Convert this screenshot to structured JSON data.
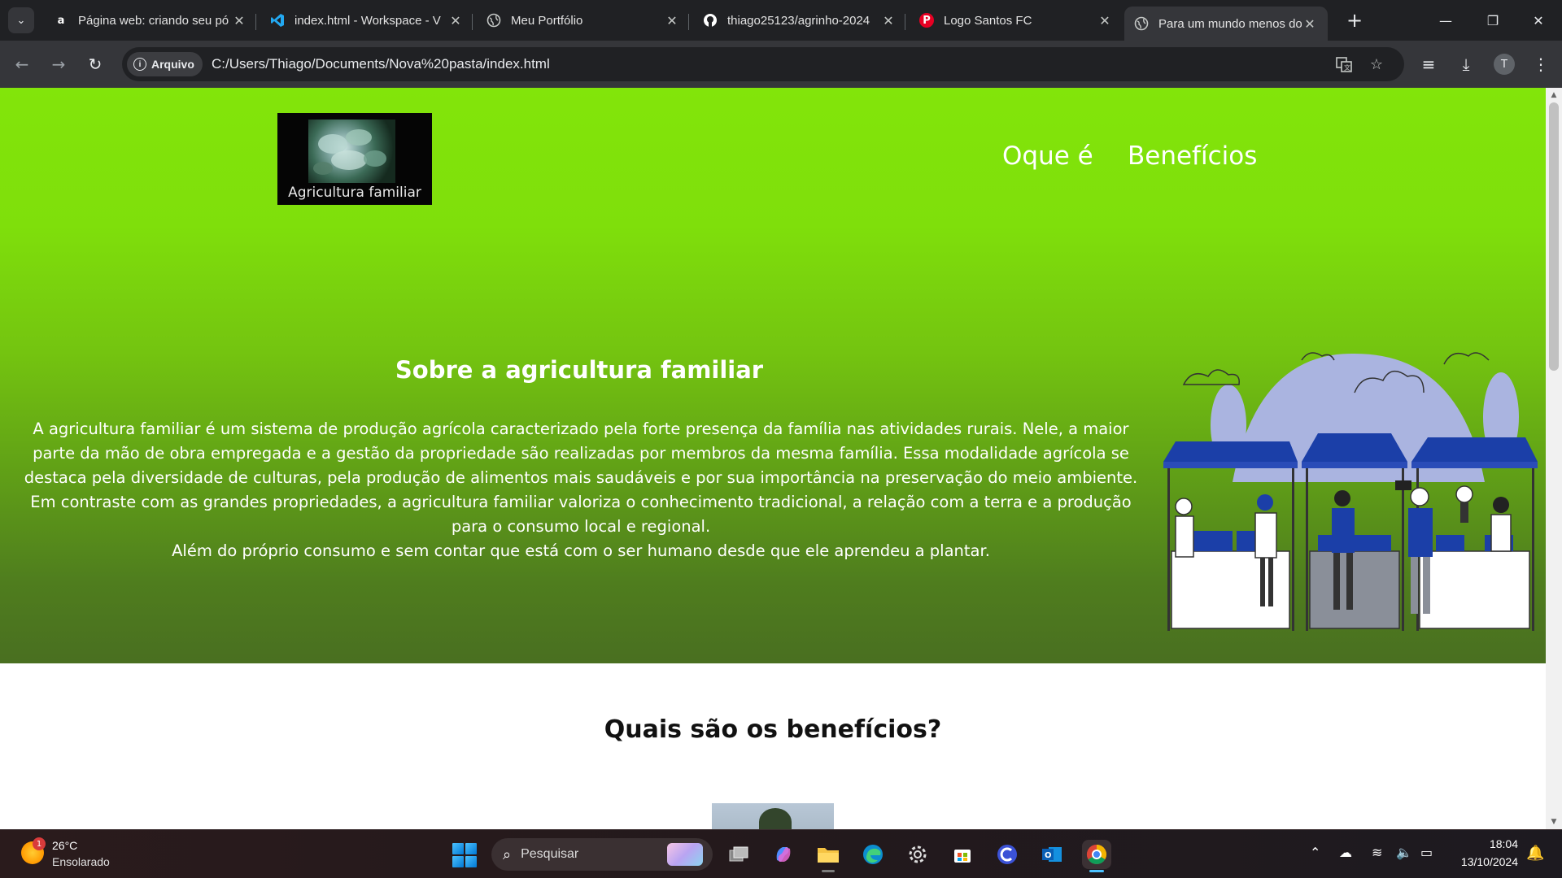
{
  "browser": {
    "tabs": [
      {
        "title": "Página web: criando seu pó",
        "favicon": "a",
        "favicon_color": "#ffffff",
        "favicon_bg": "#202124"
      },
      {
        "title": "index.html - Workspace - V",
        "favicon": "vscode-icon",
        "favicon_color": "#23a9f2",
        "favicon_bg": "transparent"
      },
      {
        "title": "Meu Portfólio",
        "favicon": "globe-icon",
        "favicon_color": "#c4c7c5",
        "favicon_bg": "transparent"
      },
      {
        "title": "thiago25123/agrinho-2024",
        "favicon": "github-icon",
        "favicon_color": "#ffffff",
        "favicon_bg": "transparent"
      },
      {
        "title": "Logo Santos FC",
        "favicon": "pinterest-icon",
        "favicon_color": "#ffffff",
        "favicon_bg": "#e60023"
      },
      {
        "title": "Para um mundo menos do",
        "favicon": "globe-icon",
        "favicon_color": "#c4c7c5",
        "favicon_bg": "transparent",
        "active": true
      }
    ],
    "security_chip": "Arquivo",
    "url": "C:/Users/Thiago/Documents/Nova%20pasta/index.html",
    "profile_initial": "T"
  },
  "page": {
    "logo_caption": "Agricultura familiar",
    "nav": [
      "Oque é",
      "Benefícios"
    ],
    "hero_title": "Sobre a agricultura familiar",
    "hero_paragraph_lines": [
      "A agricultura familiar é um sistema de produção agrícola caracterizado pela forte presença da família nas atividades rurais. Nele, a maior",
      "parte da mão de obra empregada e a gestão da propriedade são realizadas por membros da mesma família. Essa modalidade agrícola se",
      "destaca pela diversidade de culturas, pela produção de alimentos mais saudáveis e por sua importância na preservação do meio ambiente.",
      "Em contraste com as grandes propriedades, a agricultura familiar valoriza o conhecimento tradicional, a relação com a terra e a produção",
      "para o consumo local e regional.",
      "Além do próprio consumo e sem contar que está com o ser humano desde que ele aprendeu a plantar."
    ],
    "benefits_title": "Quais são os benefícios?"
  },
  "taskbar": {
    "weather_temp": "26°C",
    "weather_condition": "Ensolarado",
    "weather_badge": "1",
    "search_label": "Pesquisar",
    "time": "18:04",
    "date": "13/10/2024",
    "apps": [
      "task-view-icon",
      "copilot-icon",
      "file-explorer-icon",
      "edge-icon",
      "settings-icon",
      "store-icon",
      "app-icon",
      "outlook-icon",
      "chrome-icon"
    ]
  },
  "colors": {
    "hero_top": "#82e50a",
    "hero_bottom": "#496f20",
    "illustration_blue": "#1b3fa8",
    "illustration_light": "#aab4e0"
  }
}
